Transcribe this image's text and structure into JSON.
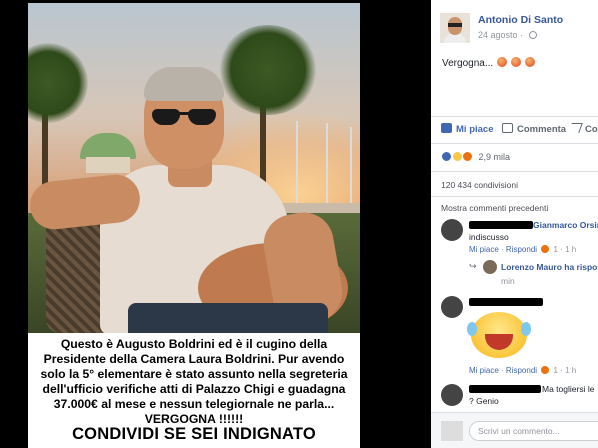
{
  "photo": {
    "caption": "Questo è Augusto Boldrini ed è il cugino della Presidente della Camera Laura Boldrini. Pur avendo solo la 5° elementare è stato assunto nella segreteria dell'ufficio verifiche atti di Palazzo Chigi e guadagna 37.000€ al mese e nessun telegiornale ne parla... VERGOGNA !!!!!!",
    "cta": "CONDIVIDI SE SEI INDIGNATO"
  },
  "post": {
    "author": "Antonio Di Santo",
    "date": "24 agosto",
    "dot": "·",
    "text": "Vergogna...",
    "text_emojis": [
      "angry-face",
      "angry-face",
      "angry-face"
    ],
    "actions": {
      "like": "Mi piace",
      "comment": "Commenta",
      "share": "Co"
    },
    "reactions_count": "2,9 mila",
    "shares": "120 434 condivisioni",
    "more_comments": "Mostra commenti precedenti"
  },
  "comments": [
    {
      "name": "Gianmarco Orsini",
      "text": "indiscusso",
      "like": "Mi piace",
      "reply": "Rispondi",
      "reacts": "1",
      "time": "1 h",
      "reply_preview": "Lorenzo Mauro ha rispos",
      "reply_time": "min"
    },
    {
      "name": "",
      "sticker": "laughing-crying-face",
      "like": "Mi piace",
      "reply": "Rispondi",
      "reacts": "1",
      "time": "1 h"
    },
    {
      "name": "",
      "text": "Ma togliersi le",
      "text2": "? Genio"
    }
  ],
  "composer": {
    "placeholder": "Scrivi un commento..."
  },
  "colors": {
    "link": "#365899",
    "like_blue": "#4267b2",
    "muted": "#90949c"
  }
}
